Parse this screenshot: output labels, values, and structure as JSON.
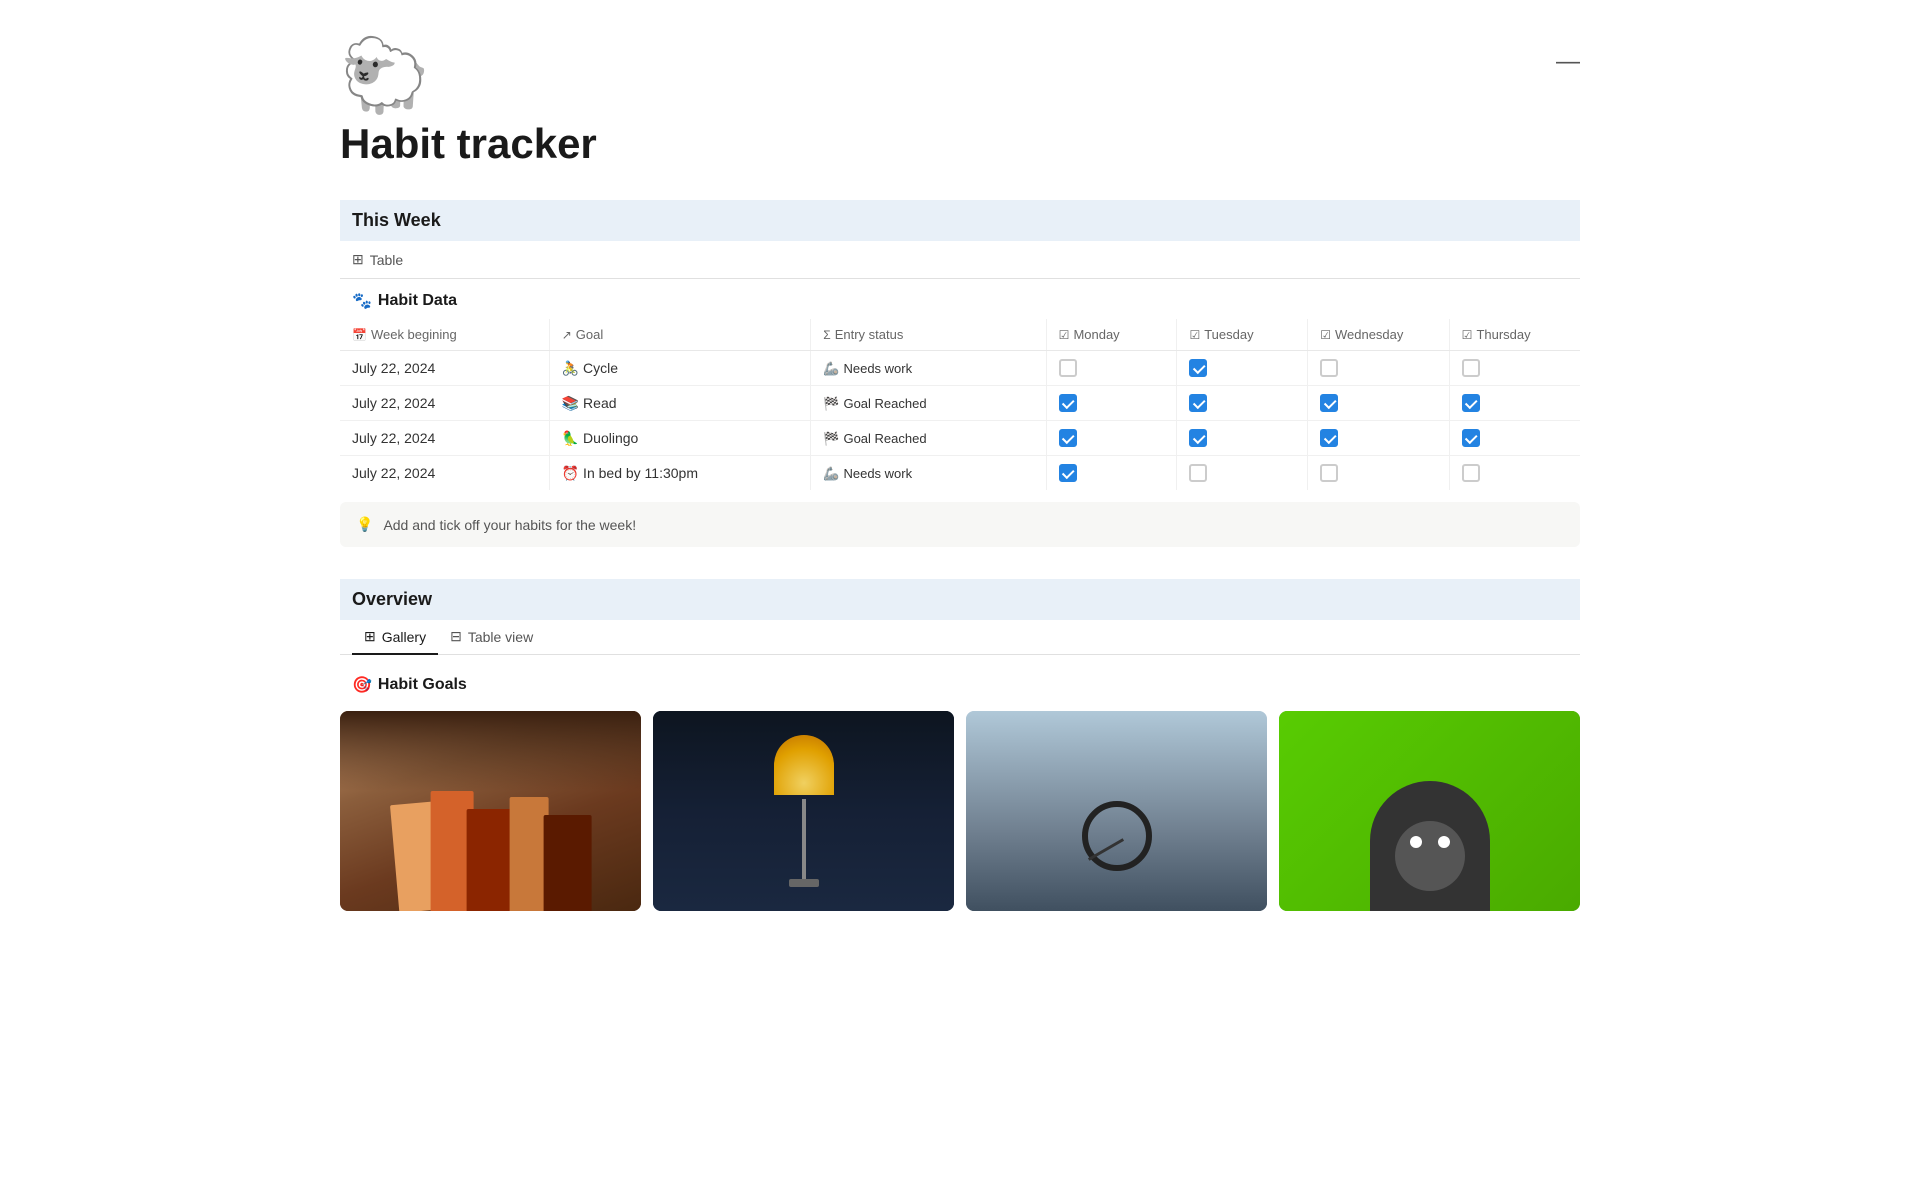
{
  "page": {
    "emoji": "🐑",
    "title": "Habit tracker",
    "minimize_label": "—"
  },
  "this_week": {
    "section_title": "This Week",
    "view_icon": "⊞",
    "view_label": "Table",
    "sub_heading_emoji": "🐾",
    "sub_heading_label": "Habit Data",
    "columns": [
      {
        "icon": "📅",
        "label": "Week begining"
      },
      {
        "icon": "↗",
        "label": "Goal"
      },
      {
        "icon": "Σ",
        "label": "Entry status"
      },
      {
        "icon": "☑",
        "label": "Monday"
      },
      {
        "icon": "☑",
        "label": "Tuesday"
      },
      {
        "icon": "☑",
        "label": "Wednesday"
      },
      {
        "icon": "☑",
        "label": "Thursday"
      }
    ],
    "rows": [
      {
        "date": "July 22, 2024",
        "goal_emoji": "🚴",
        "goal": "Cycle",
        "status_emoji": "🦾",
        "status": "Needs work",
        "monday": false,
        "tuesday": true,
        "wednesday": false,
        "thursday": false
      },
      {
        "date": "July 22, 2024",
        "goal_emoji": "📚",
        "goal": "Read",
        "status_emoji": "🏁",
        "status": "Goal Reached",
        "monday": true,
        "tuesday": true,
        "wednesday": true,
        "thursday": true
      },
      {
        "date": "July 22, 2024",
        "goal_emoji": "🦜",
        "goal": "Duolingo",
        "status_emoji": "🏁",
        "status": "Goal Reached",
        "monday": true,
        "tuesday": true,
        "wednesday": true,
        "thursday": true
      },
      {
        "date": "July 22, 2024",
        "goal_emoji": "⏰",
        "goal": "In bed by 11:30pm",
        "status_emoji": "🦾",
        "status": "Needs work",
        "monday": true,
        "tuesday": false,
        "wednesday": false,
        "thursday": false
      }
    ],
    "tip_emoji": "💡",
    "tip_text": "Add and tick off your habits for the week!"
  },
  "overview": {
    "section_title": "Overview",
    "tabs": [
      {
        "icon": "⊞",
        "label": "Gallery",
        "active": true
      },
      {
        "icon": "⊟",
        "label": "Table view",
        "active": false
      }
    ],
    "sub_heading_emoji": "🎯",
    "sub_heading_label": "Habit Goals",
    "cards": [
      {
        "id": "books",
        "type": "books"
      },
      {
        "id": "lamp",
        "type": "lamp"
      },
      {
        "id": "cycle",
        "type": "cycle"
      },
      {
        "id": "duolingo",
        "type": "duolingo"
      }
    ]
  }
}
